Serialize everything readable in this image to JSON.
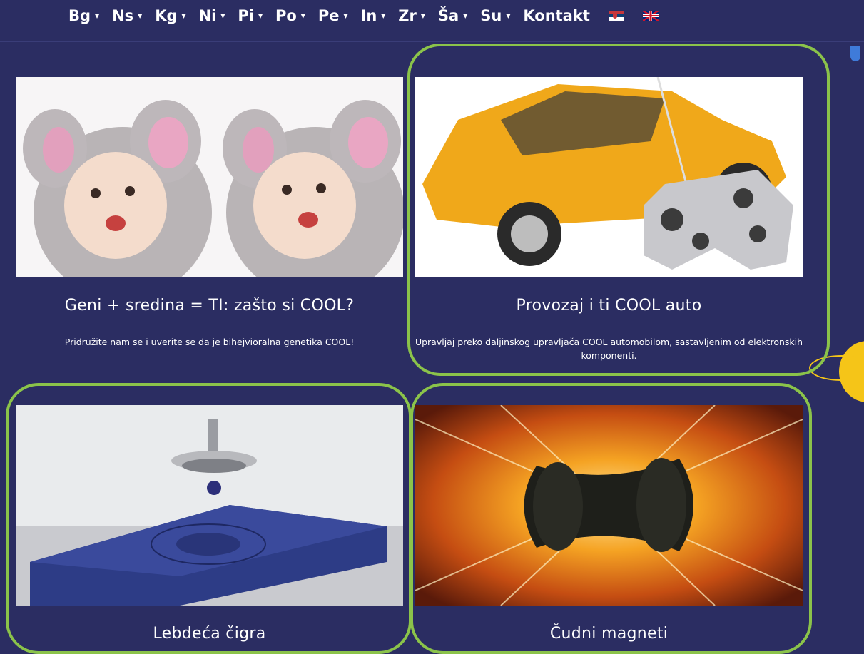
{
  "nav": {
    "items": [
      {
        "label": "Bg"
      },
      {
        "label": "Ns"
      },
      {
        "label": "Kg"
      },
      {
        "label": "Ni"
      },
      {
        "label": "Pi"
      },
      {
        "label": "Po"
      },
      {
        "label": "Pe"
      },
      {
        "label": "In"
      },
      {
        "label": "Zr"
      },
      {
        "label": "Ša"
      },
      {
        "label": "Su"
      }
    ],
    "contact_label": "Kontakt",
    "caret": "▾"
  },
  "cards": [
    {
      "title": "Geni + sredina = TI: zašto si COOL?",
      "description": "Pridružite nam se i uverite se da je bihejvioralna genetika COOL!"
    },
    {
      "title": "Provozaj i ti COOL auto",
      "description": "Upravljaj preko daljinskog upravljača COOL automobilom, sastavljenim od elektronskih komponenti."
    },
    {
      "title": "Lebdeća čigra",
      "description": ""
    },
    {
      "title": "Čudni magneti",
      "description": ""
    }
  ],
  "colors": {
    "background": "#2b2d62",
    "highlight_outline": "#8bc34a",
    "accent_yellow": "#f5c518"
  }
}
